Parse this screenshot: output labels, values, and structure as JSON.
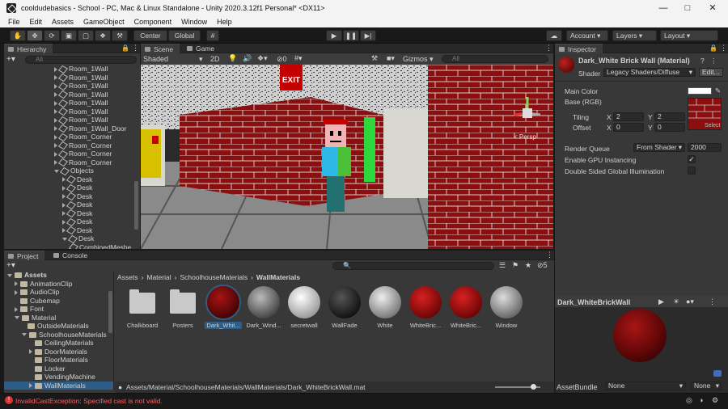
{
  "window": {
    "title": "cooldudebasics - School - PC, Mac & Linux Standalone - Unity 2020.3.12f1 Personal* <DX11>"
  },
  "menu": [
    "File",
    "Edit",
    "Assets",
    "GameObject",
    "Component",
    "Window",
    "Help"
  ],
  "toolbar": {
    "center": "Center",
    "global": "Global",
    "account": "Account",
    "layers": "Layers",
    "layout": "Layout"
  },
  "hierarchy": {
    "tab": "Hierarchy",
    "search_placeholder": "All",
    "items": [
      {
        "label": "Room_1Wall",
        "depth": 0,
        "kind": "object"
      },
      {
        "label": "Room_1Wall",
        "depth": 0,
        "kind": "object"
      },
      {
        "label": "Room_1Wall",
        "depth": 0,
        "kind": "object"
      },
      {
        "label": "Room_1Wall",
        "depth": 0,
        "kind": "object"
      },
      {
        "label": "Room_1Wall",
        "depth": 0,
        "kind": "object"
      },
      {
        "label": "Room_1Wall",
        "depth": 0,
        "kind": "object"
      },
      {
        "label": "Room_1Wall",
        "depth": 0,
        "kind": "object"
      },
      {
        "label": "Room_1Wall_Door",
        "depth": 0,
        "kind": "object"
      },
      {
        "label": "Room_Corner",
        "depth": 0,
        "kind": "object"
      },
      {
        "label": "Room_Corner",
        "depth": 0,
        "kind": "object"
      },
      {
        "label": "Room_Corner",
        "depth": 0,
        "kind": "object"
      },
      {
        "label": "Room_Corner",
        "depth": 0,
        "kind": "object"
      },
      {
        "label": "Objects",
        "depth": 0,
        "kind": "open"
      },
      {
        "label": "Desk",
        "depth": 1,
        "kind": "object"
      },
      {
        "label": "Desk",
        "depth": 1,
        "kind": "object"
      },
      {
        "label": "Desk",
        "depth": 1,
        "kind": "object"
      },
      {
        "label": "Desk",
        "depth": 1,
        "kind": "object"
      },
      {
        "label": "Desk",
        "depth": 1,
        "kind": "object"
      },
      {
        "label": "Desk",
        "depth": 1,
        "kind": "object"
      },
      {
        "label": "Desk",
        "depth": 1,
        "kind": "object"
      },
      {
        "label": "Desk",
        "depth": 1,
        "kind": "open"
      },
      {
        "label": "CombinedMeshe",
        "depth": 2,
        "kind": "leaf"
      }
    ]
  },
  "scene": {
    "tab_scene": "Scene",
    "tab_game": "Game",
    "shading": "Shaded",
    "mode2d": "2D",
    "hidden_count": "0",
    "gizmos": "Gizmos",
    "search_placeholder": "All",
    "persp": "< Persp",
    "exit_sign": "EXIT"
  },
  "project": {
    "tab_project": "Project",
    "tab_console": "Console",
    "hidden_count": "5",
    "tree": [
      {
        "label": "Assets",
        "depth": 0,
        "open": true,
        "bold": true
      },
      {
        "label": "AnimationClip",
        "depth": 1,
        "open": false
      },
      {
        "label": "AudioClip",
        "depth": 1,
        "open": false
      },
      {
        "label": "Cubemap",
        "depth": 1,
        "open": false,
        "noarrow": true
      },
      {
        "label": "Font",
        "depth": 1,
        "open": false
      },
      {
        "label": "Material",
        "depth": 1,
        "open": true
      },
      {
        "label": "OutsideMaterials",
        "depth": 2,
        "open": false,
        "noarrow": true
      },
      {
        "label": "SchoolhouseMaterials",
        "depth": 2,
        "open": true
      },
      {
        "label": "CeilingMaterials",
        "depth": 3,
        "open": false,
        "noarrow": true
      },
      {
        "label": "DoorMaterials",
        "depth": 3,
        "open": false
      },
      {
        "label": "FloorMaterials",
        "depth": 3,
        "open": false,
        "noarrow": true
      },
      {
        "label": "Locker",
        "depth": 3,
        "open": false,
        "noarrow": true
      },
      {
        "label": "VendingMachine",
        "depth": 3,
        "open": false,
        "noarrow": true
      },
      {
        "label": "WallMaterials",
        "depth": 3,
        "open": false,
        "selected": true
      }
    ],
    "breadcrumb": [
      "Assets",
      "Material",
      "SchoolhouseMaterials",
      "WallMaterials"
    ],
    "assets": [
      {
        "label": "Chalkboard",
        "kind": "folder"
      },
      {
        "label": "Posters",
        "kind": "folder"
      },
      {
        "label": "Dark_Whit...",
        "kind": "darkred",
        "selected": true
      },
      {
        "label": "Dark_Wind...",
        "kind": "gray"
      },
      {
        "label": "secretwall",
        "kind": "white"
      },
      {
        "label": "WallFade",
        "kind": "black"
      },
      {
        "label": "White",
        "kind": "lightgray"
      },
      {
        "label": "WhiteBric...",
        "kind": "red"
      },
      {
        "label": "WhiteBric...",
        "kind": "red"
      },
      {
        "label": "Window",
        "kind": "window"
      }
    ],
    "path": "Assets/Material/SchoolhouseMaterials/WallMaterials/Dark_WhiteBrickWall.mat"
  },
  "inspector": {
    "tab": "Inspector",
    "title": "Dark_White Brick Wall (Material)",
    "shader_label": "Shader",
    "shader_value": "Legacy Shaders/Diffuse",
    "edit": "Edit...",
    "main_color": "Main Color",
    "base_rgb": "Base (RGB)",
    "tiling": "Tiling",
    "offset": "Offset",
    "tiling_x": "2",
    "tiling_y": "2",
    "offset_x": "0",
    "offset_y": "0",
    "x": "X",
    "y": "Y",
    "select": "Select",
    "render_queue": "Render Queue",
    "render_queue_mode": "From Shader",
    "render_queue_value": "2000",
    "gpu_instancing": "Enable GPU Instancing",
    "double_sided": "Double Sided Global Illumination",
    "preview_title": "Dark_WhiteBrickWall",
    "asset_bundle": "AssetBundle",
    "bundle_value": "None",
    "bundle_variant": "None"
  },
  "status": {
    "error": "InvalidCastException: Specified cast is not valid."
  },
  "colors": {
    "accent": "#2c5d87",
    "brick": "#8c0f0f",
    "error": "#ff5f5f"
  }
}
